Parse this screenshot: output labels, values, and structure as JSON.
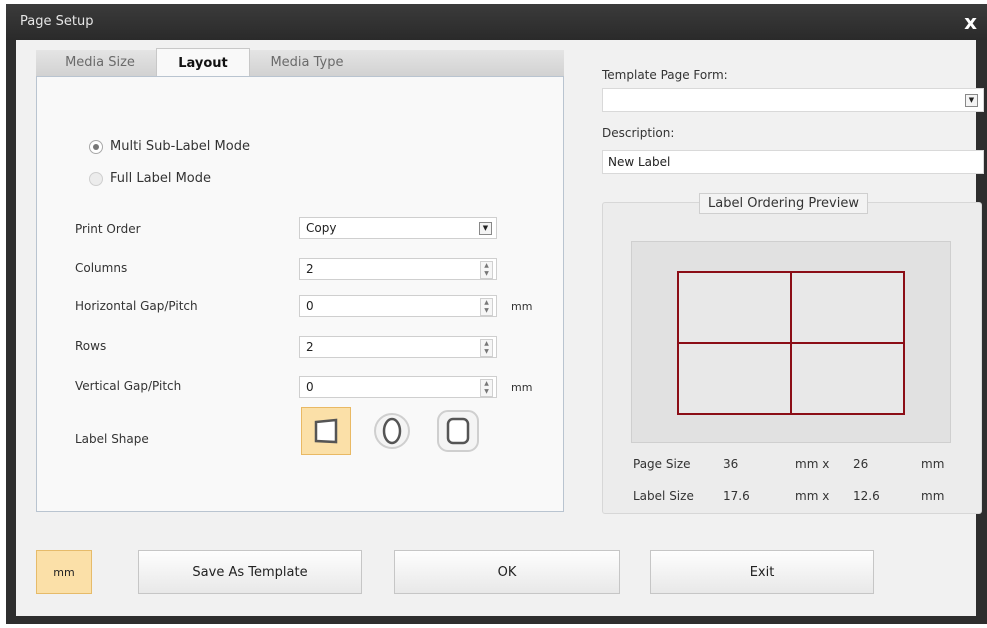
{
  "window": {
    "title": "Page Setup",
    "close_glyph": "x"
  },
  "tabs": [
    {
      "label": "Media Size",
      "active": false
    },
    {
      "label": "Layout",
      "active": true
    },
    {
      "label": "Media Type",
      "active": false
    }
  ],
  "layout": {
    "modes": [
      {
        "label": "Multi Sub-Label Mode",
        "selected": true
      },
      {
        "label": "Full Label Mode",
        "selected": false
      }
    ],
    "print_order": {
      "label": "Print Order",
      "value": "Copy"
    },
    "columns": {
      "label": "Columns",
      "value": "2"
    },
    "horizontal_gap": {
      "label": "Horizontal Gap/Pitch",
      "value": "0",
      "unit": "mm"
    },
    "rows": {
      "label": "Rows",
      "value": "2"
    },
    "vertical_gap": {
      "label": "Vertical Gap/Pitch",
      "value": "0",
      "unit": "mm"
    },
    "label_shape": {
      "label": "Label Shape",
      "options": [
        "rectangle-icon",
        "ellipse-icon",
        "rounded-rectangle-icon"
      ],
      "selected": "rectangle-icon"
    }
  },
  "right": {
    "template_label": "Template Page Form:",
    "template_value": "",
    "description_label": "Description:",
    "description_value": "New Label",
    "preview": {
      "title": "Label Ordering Preview",
      "grid_columns": 2,
      "grid_rows": 2,
      "page_size_label": "Page Size",
      "page_width": "36",
      "page_height": "26",
      "label_size_label": "Label Size",
      "label_width": "17.6",
      "label_height": "12.6",
      "mm_x": "mm  x",
      "mm": "mm"
    }
  },
  "buttons": {
    "unit": "mm",
    "save_template": "Save As Template",
    "ok": "OK",
    "exit": "Exit"
  },
  "colors": {
    "label_outline": "#8b0d16",
    "accent": "#fbe0a8"
  }
}
